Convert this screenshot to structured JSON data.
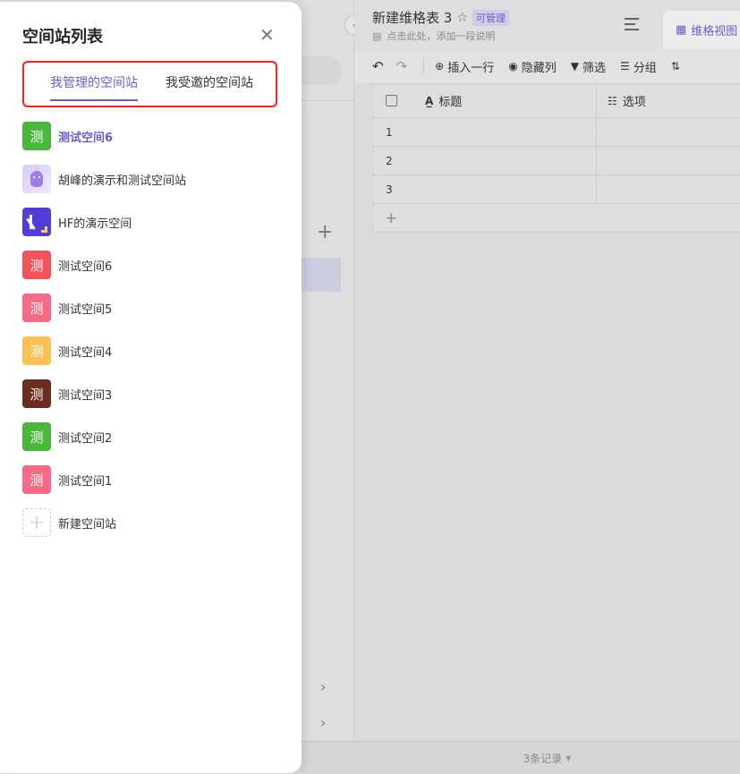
{
  "panel": {
    "title": "空间站列表",
    "tabs": [
      {
        "label": "我管理的空间站",
        "active": true
      },
      {
        "label": "我受邀的空间站",
        "active": false
      }
    ],
    "spaces": [
      {
        "name": "测试空间6",
        "avatar_text": "测",
        "color": "#4ab63c",
        "selected": true
      },
      {
        "name": "胡峰的演示和测试空间站",
        "avatar_type": "unicorn"
      },
      {
        "name": "HF的演示空间",
        "avatar_type": "hf-logo"
      },
      {
        "name": "测试空间6",
        "avatar_text": "测",
        "color": "#f0545a"
      },
      {
        "name": "测试空间5",
        "avatar_text": "测",
        "color": "#f56a85"
      },
      {
        "name": "测试空间4",
        "avatar_text": "测",
        "color": "#fbc155"
      },
      {
        "name": "测试空间3",
        "avatar_text": "测",
        "color": "#6b2d22"
      },
      {
        "name": "测试空间2",
        "avatar_text": "测",
        "color": "#4ab63c"
      },
      {
        "name": "测试空间1",
        "avatar_text": "测",
        "color": "#f56a85"
      }
    ],
    "create_label": "新建空间站",
    "accent_color": "#6a5fc9",
    "highlight_color": "#ff1f1f"
  },
  "sheet": {
    "title": "新建维格表 3",
    "permission": "可管理",
    "description": "点击此处，添加一段说明",
    "view_tab": "维格视图",
    "toolbar": {
      "insert_row": "插入一行",
      "hide_cols": "隐藏列",
      "filter": "筛选",
      "group": "分组"
    },
    "columns": [
      "标题",
      "选项"
    ],
    "rows": [
      "1",
      "2",
      "3"
    ],
    "footer": "3条记录"
  }
}
